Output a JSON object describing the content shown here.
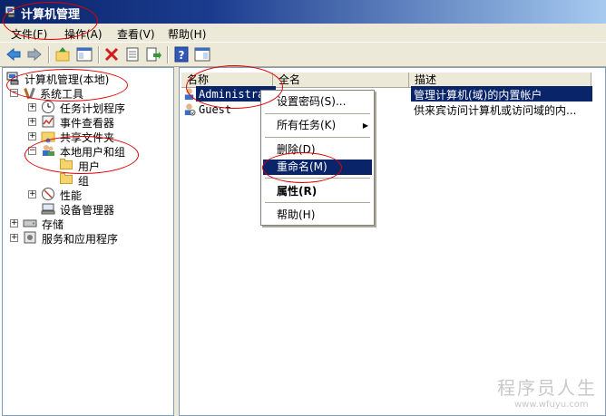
{
  "window": {
    "title": "计算机管理"
  },
  "menu": [
    {
      "label": "文件(F)"
    },
    {
      "label": "操作(A)"
    },
    {
      "label": "查看(V)"
    },
    {
      "label": "帮助(H)"
    }
  ],
  "tree": {
    "root": "计算机管理(本地)",
    "system_tools": "系统工具",
    "task_scheduler": "任务计划程序",
    "event_viewer": "事件查看器",
    "shared_folders": "共享文件夹",
    "local_users_groups": "本地用户和组",
    "users": "用户",
    "groups": "组",
    "performance": "性能",
    "device_manager": "设备管理器",
    "storage": "存储",
    "services_apps": "服务和应用程序",
    "expand_plus": "+",
    "expand_minus": "−"
  },
  "list": {
    "columns": [
      "名称",
      "全名",
      "描述"
    ],
    "rows": [
      {
        "name": "Administrator",
        "fullname": "",
        "description": "管理计算机(域)的内置帐户"
      },
      {
        "name": "Guest",
        "fullname": "",
        "description": "供来宾访问计算机或访问域的内..."
      }
    ]
  },
  "context_menu": {
    "set_password": "设置密码(S)...",
    "all_tasks": "所有任务(K)",
    "submenu_arrow": "▶",
    "delete": "删除(D)",
    "rename": "重命名(M)",
    "properties": "属性(R)",
    "help": "帮助(H)"
  },
  "watermark": {
    "text": "程序员人生",
    "url": "www.wfuyu.com"
  },
  "colors": {
    "selection": "#0a246a",
    "annotation": "#e00000",
    "toolbar_bg": "#ece9d8"
  }
}
